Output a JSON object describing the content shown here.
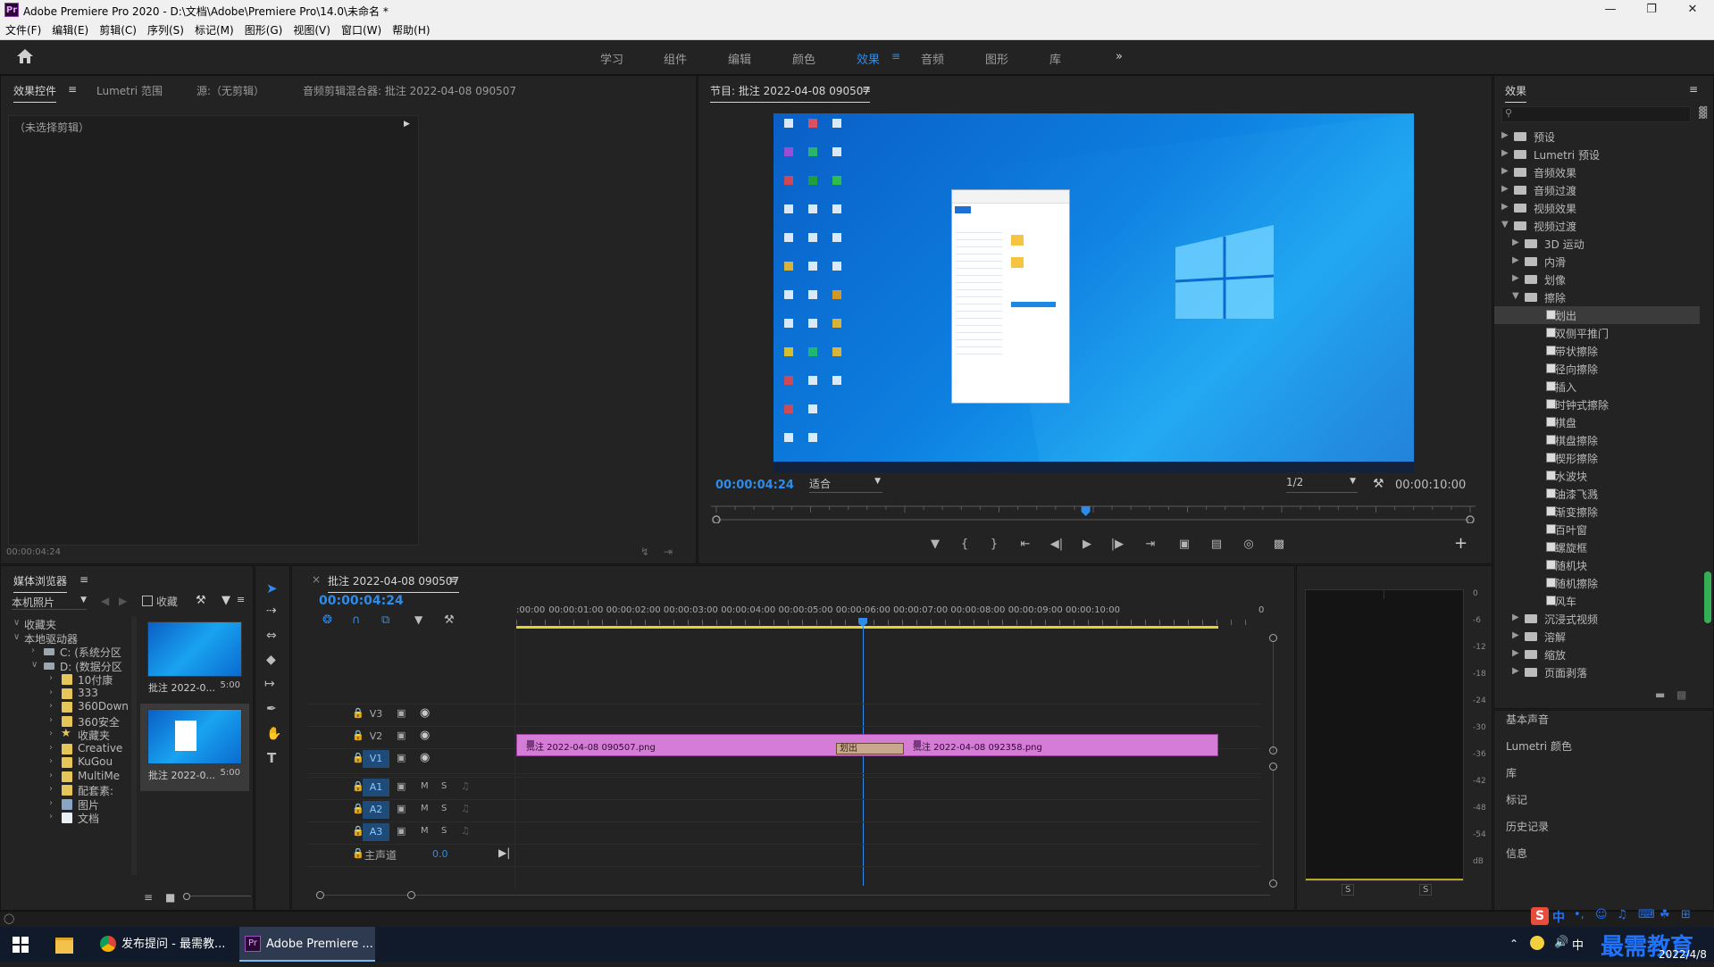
{
  "window": {
    "title": "Adobe Premiere Pro 2020 - D:\\文档\\Adobe\\Premiere Pro\\14.0\\未命名 *",
    "app_icon": "Pr"
  },
  "menu": [
    "文件(F)",
    "编辑(E)",
    "剪辑(C)",
    "序列(S)",
    "标记(M)",
    "图形(G)",
    "视图(V)",
    "窗口(W)",
    "帮助(H)"
  ],
  "workspaces": [
    "学习",
    "组件",
    "编辑",
    "颜色",
    "效果",
    "音频",
    "图形",
    "库"
  ],
  "active_workspace": "效果",
  "source_panel": {
    "tabs": [
      "效果控件",
      "Lumetri 范围",
      "源:（无剪辑）",
      "音频剪辑混合器: 批注 2022-04-08 090507"
    ],
    "no_clip": "（未选择剪辑）",
    "timecode": "00:00:04:24"
  },
  "program_monitor": {
    "title": "节目: 批注 2022-04-08 090507",
    "timecode": "00:00:04:24",
    "fit": "适合",
    "resolution": "1/2",
    "duration": "00:00:10:00",
    "playhead_fraction": 0.49
  },
  "effects_panel": {
    "title": "效果",
    "items": [
      {
        "label": "预设",
        "level": 0,
        "type": "folder",
        "open": false
      },
      {
        "label": "Lumetri 预设",
        "level": 0,
        "type": "folder",
        "open": false
      },
      {
        "label": "音频效果",
        "level": 0,
        "type": "folder",
        "open": false
      },
      {
        "label": "音频过渡",
        "level": 0,
        "type": "folder",
        "open": false
      },
      {
        "label": "视频效果",
        "level": 0,
        "type": "folder",
        "open": false
      },
      {
        "label": "视频过渡",
        "level": 0,
        "type": "folder",
        "open": true
      },
      {
        "label": "3D 运动",
        "level": 1,
        "type": "folder",
        "open": false
      },
      {
        "label": "内滑",
        "level": 1,
        "type": "folder",
        "open": false
      },
      {
        "label": "划像",
        "level": 1,
        "type": "folder",
        "open": false
      },
      {
        "label": "擦除",
        "level": 1,
        "type": "folder",
        "open": true
      },
      {
        "label": "划出",
        "level": 2,
        "type": "effect",
        "selected": true
      },
      {
        "label": "双侧平推门",
        "level": 2,
        "type": "effect"
      },
      {
        "label": "带状擦除",
        "level": 2,
        "type": "effect"
      },
      {
        "label": "径向擦除",
        "level": 2,
        "type": "effect"
      },
      {
        "label": "插入",
        "level": 2,
        "type": "effect"
      },
      {
        "label": "时钟式擦除",
        "level": 2,
        "type": "effect"
      },
      {
        "label": "棋盘",
        "level": 2,
        "type": "effect"
      },
      {
        "label": "棋盘擦除",
        "level": 2,
        "type": "effect"
      },
      {
        "label": "楔形擦除",
        "level": 2,
        "type": "effect"
      },
      {
        "label": "水波块",
        "level": 2,
        "type": "effect"
      },
      {
        "label": "油漆飞溅",
        "level": 2,
        "type": "effect"
      },
      {
        "label": "渐变擦除",
        "level": 2,
        "type": "effect"
      },
      {
        "label": "百叶窗",
        "level": 2,
        "type": "effect"
      },
      {
        "label": "螺旋框",
        "level": 2,
        "type": "effect"
      },
      {
        "label": "随机块",
        "level": 2,
        "type": "effect"
      },
      {
        "label": "随机擦除",
        "level": 2,
        "type": "effect"
      },
      {
        "label": "风车",
        "level": 2,
        "type": "effect"
      },
      {
        "label": "沉浸式视频",
        "level": 1,
        "type": "folder",
        "open": false
      },
      {
        "label": "溶解",
        "level": 1,
        "type": "folder",
        "open": false
      },
      {
        "label": "缩放",
        "level": 1,
        "type": "folder",
        "open": false
      },
      {
        "label": "页面剥落",
        "level": 1,
        "type": "folder",
        "open": false
      }
    ],
    "collapsed_panels": [
      "基本声音",
      "Lumetri 颜色",
      "库",
      "标记",
      "历史记录",
      "信息"
    ]
  },
  "media_browser": {
    "title": "媒体浏览器",
    "location": "本机照片",
    "favorites_label": "收藏",
    "tree": [
      {
        "label": "收藏夹",
        "level": 0,
        "open": true
      },
      {
        "label": "本地驱动器",
        "level": 0,
        "open": true
      },
      {
        "label": "C: (系统分区",
        "level": 1,
        "icon": "drive"
      },
      {
        "label": "D: (数据分区",
        "level": 1,
        "icon": "drive",
        "open": true
      },
      {
        "label": "10付康",
        "level": 2,
        "icon": "folder"
      },
      {
        "label": "333",
        "level": 2,
        "icon": "folder"
      },
      {
        "label": "360Down",
        "level": 2,
        "icon": "folder"
      },
      {
        "label": "360安全",
        "level": 2,
        "icon": "folder"
      },
      {
        "label": "收藏夹",
        "level": 2,
        "icon": "star"
      },
      {
        "label": "Creative",
        "level": 2,
        "icon": "folder"
      },
      {
        "label": "KuGou",
        "level": 2,
        "icon": "folder"
      },
      {
        "label": "MultiMe",
        "level": 2,
        "icon": "folder"
      },
      {
        "label": "配套素:",
        "level": 2,
        "icon": "folder"
      },
      {
        "label": "图片",
        "level": 2,
        "icon": "image"
      },
      {
        "label": "文档",
        "level": 2,
        "icon": "doc"
      }
    ],
    "thumbnails": [
      {
        "name": "批注 2022-0...",
        "duration": "5:00"
      },
      {
        "name": "批注 2022-0...",
        "duration": "5:00"
      }
    ]
  },
  "timeline": {
    "sequence_name": "批注 2022-04-08 090507",
    "timecode": "00:00:04:24",
    "ruler": [
      ":00:00",
      "00:00:01:00",
      "00:00:02:00",
      "00:00:03:00",
      "00:00:04:00",
      "00:00:05:00",
      "00:00:06:00",
      "00:00:07:00",
      "00:00:08:00",
      "00:00:09:00",
      "00:00:10:00",
      "0"
    ],
    "video_tracks": [
      "V3",
      "V2",
      "V1"
    ],
    "audio_tracks": [
      "A1",
      "A2",
      "A3"
    ],
    "master_label": "主声道",
    "master_value": "0.0",
    "clip1": "批注 2022-04-08 090507.png",
    "clip2": "批注 2022-04-08 092358.png",
    "transition": "划出",
    "mute": "M",
    "solo": "S"
  },
  "audio_meter": {
    "scale": [
      "0",
      "-6",
      "-12",
      "-18",
      "-24",
      "-30",
      "-36",
      "-42",
      "-48",
      "-54",
      "dB"
    ],
    "solo_labels": [
      "S",
      "S"
    ]
  },
  "taskbar": {
    "items": [
      "发布提问 - 最需教...",
      "Adobe Premiere ..."
    ],
    "time_line2": "2022/4/8",
    "watermark": "最需教育",
    "ime": "中"
  }
}
